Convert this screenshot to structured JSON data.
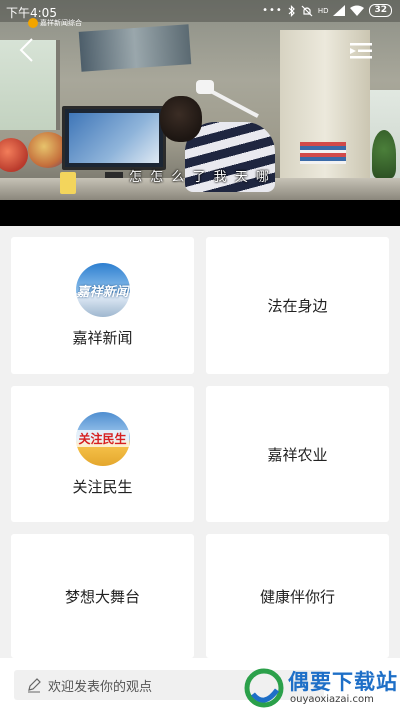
{
  "status_bar": {
    "time": "下午4:05",
    "dots": "•••",
    "network": "HD",
    "battery": "32"
  },
  "channel_badge": "嘉祥新闻综合",
  "video": {
    "subtitle": "怎 怎 么 了 我 天 哪"
  },
  "cards": [
    {
      "label": "嘉祥新闻",
      "icon_text": "嘉祥新闻",
      "icon": "news-logo-icon"
    },
    {
      "label": "法在身边"
    },
    {
      "label": "关注民生",
      "icon_text": "关注民生",
      "icon": "people-life-logo-icon"
    },
    {
      "label": "嘉祥农业"
    },
    {
      "label": "梦想大舞台"
    },
    {
      "label": "健康伴你行"
    }
  ],
  "comment": {
    "placeholder": "欢迎发表你的观点"
  },
  "watermark": {
    "title": "偶要下载站",
    "url": "ouyaoxiazai.com"
  },
  "colors": {
    "background": "#f1f1f1",
    "card": "#ffffff",
    "watermark_blue": "#1e6fc7"
  }
}
